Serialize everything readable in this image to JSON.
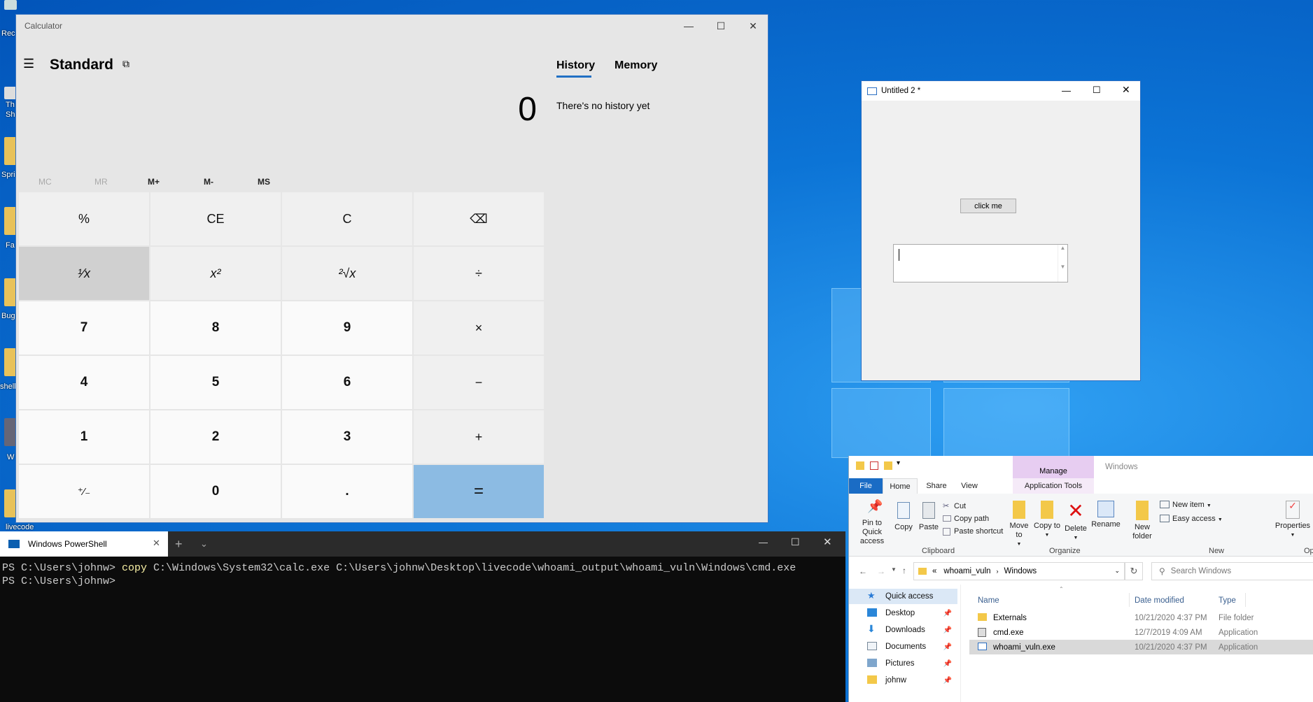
{
  "desktop": {
    "labels": [
      "Rec",
      "Th",
      "Sh",
      "Spri",
      "Fa",
      "Bug",
      "shell",
      "W",
      "livecode"
    ]
  },
  "calculator": {
    "title": "Calculator",
    "mode": "Standard",
    "display": "0",
    "tabs": [
      "History",
      "Memory"
    ],
    "history_empty": "There's no history yet",
    "memory": [
      "MC",
      "MR",
      "M+",
      "M-",
      "MS"
    ],
    "keys": [
      [
        "%",
        "CE",
        "C",
        "⌫"
      ],
      [
        "¹⁄x",
        "x²",
        "²√x",
        "÷"
      ],
      [
        "7",
        "8",
        "9",
        "×"
      ],
      [
        "4",
        "5",
        "6",
        "−"
      ],
      [
        "1",
        "2",
        "3",
        "+"
      ],
      [
        "⁺⁄₋",
        "0",
        ".",
        "="
      ]
    ]
  },
  "vbform": {
    "title": "Untitled 2 *",
    "button": "click me"
  },
  "powershell": {
    "tab": "Windows PowerShell",
    "prompt": "PS C:\\Users\\johnw> ",
    "cmd": "copy",
    "args": " C:\\Windows\\System32\\calc.exe C:\\Users\\johnw\\Desktop\\livecode\\whoami_output\\whoami_vuln\\Windows\\cmd.exe"
  },
  "explorer": {
    "manage": "Manage",
    "window_title": "Windows",
    "tabs": [
      "File",
      "Home",
      "Share",
      "View",
      "Application Tools"
    ],
    "ribbon": {
      "pin": "Pin to Quick access",
      "copy": "Copy",
      "paste": "Paste",
      "cut": "Cut",
      "copy_path": "Copy path",
      "paste_shortcut": "Paste shortcut",
      "move_to": "Move to",
      "copy_to": "Copy to",
      "delete": "Delete",
      "rename": "Rename",
      "new_folder": "New folder",
      "new_item": "New item",
      "easy_access": "Easy access",
      "properties": "Properties"
    },
    "groups": [
      "Clipboard",
      "Organize",
      "New",
      "Op"
    ],
    "path": [
      "«",
      "whoami_vuln",
      "Windows"
    ],
    "search_placeholder": "Search Windows",
    "nav": [
      "Quick access",
      "Desktop",
      "Downloads",
      "Documents",
      "Pictures",
      "johnw"
    ],
    "columns": [
      "Name",
      "Date modified",
      "Type"
    ],
    "files": [
      {
        "name": "Externals",
        "date": "10/21/2020 4:37 PM",
        "type": "File folder"
      },
      {
        "name": "cmd.exe",
        "date": "12/7/2019 4:09 AM",
        "type": "Application"
      },
      {
        "name": "whoami_vuln.exe",
        "date": "10/21/2020 4:37 PM",
        "type": "Application"
      }
    ]
  }
}
